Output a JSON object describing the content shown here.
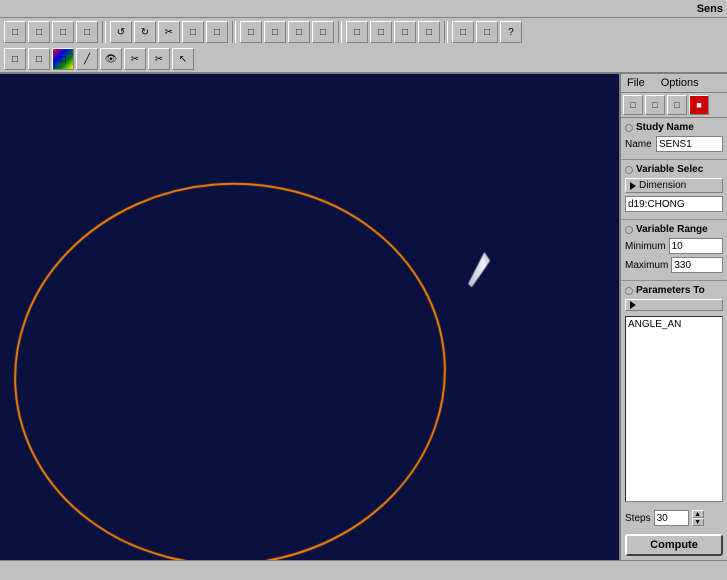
{
  "title": "Sens",
  "menubar": {
    "file": "File",
    "options": "Options"
  },
  "panel": {
    "new_icon": "□",
    "open_icon": "📂",
    "save_icon": "💾"
  },
  "study_name": {
    "label": "Study Name",
    "name_label": "Name",
    "name_value": "SENS1"
  },
  "variable_selection": {
    "label": "Variable Selec",
    "button_label": "Dimension",
    "variable_value": "d19:CHONG"
  },
  "variable_range": {
    "label": "Variable Range",
    "min_label": "Minimum",
    "min_value": "10",
    "max_label": "Maximum",
    "max_value": "330"
  },
  "parameters_to": {
    "label": "Parameters To",
    "param_value": "ANGLE_AN"
  },
  "steps": {
    "label": "Steps",
    "value": "30"
  },
  "compute_button": "Compute",
  "toolbar": {
    "icons": [
      "□",
      "□",
      "↺",
      "↻",
      "✂",
      "□",
      "□",
      "□",
      "□",
      "□",
      "□",
      "□",
      "□",
      "□",
      "□",
      "□",
      "□",
      "□",
      "□",
      "□",
      "□",
      "?"
    ]
  }
}
